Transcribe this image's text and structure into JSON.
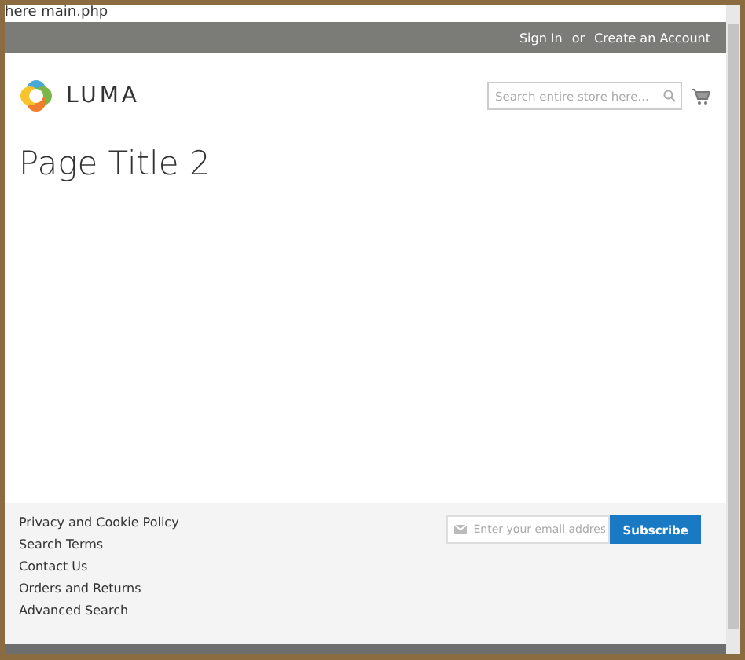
{
  "debug_text": "here main.php",
  "header_links": {
    "sign_in": "Sign In",
    "separator": "or",
    "create_account": "Create an Account"
  },
  "logo": {
    "text": "LUMA"
  },
  "search": {
    "placeholder": "Search entire store here..."
  },
  "page_title": "Page Title 2",
  "footer_links": [
    "Privacy and Cookie Policy",
    "Search Terms",
    "Contact Us",
    "Orders and Returns",
    "Advanced Search"
  ],
  "newsletter": {
    "placeholder": "Enter your email addres",
    "button": "Subscribe"
  }
}
